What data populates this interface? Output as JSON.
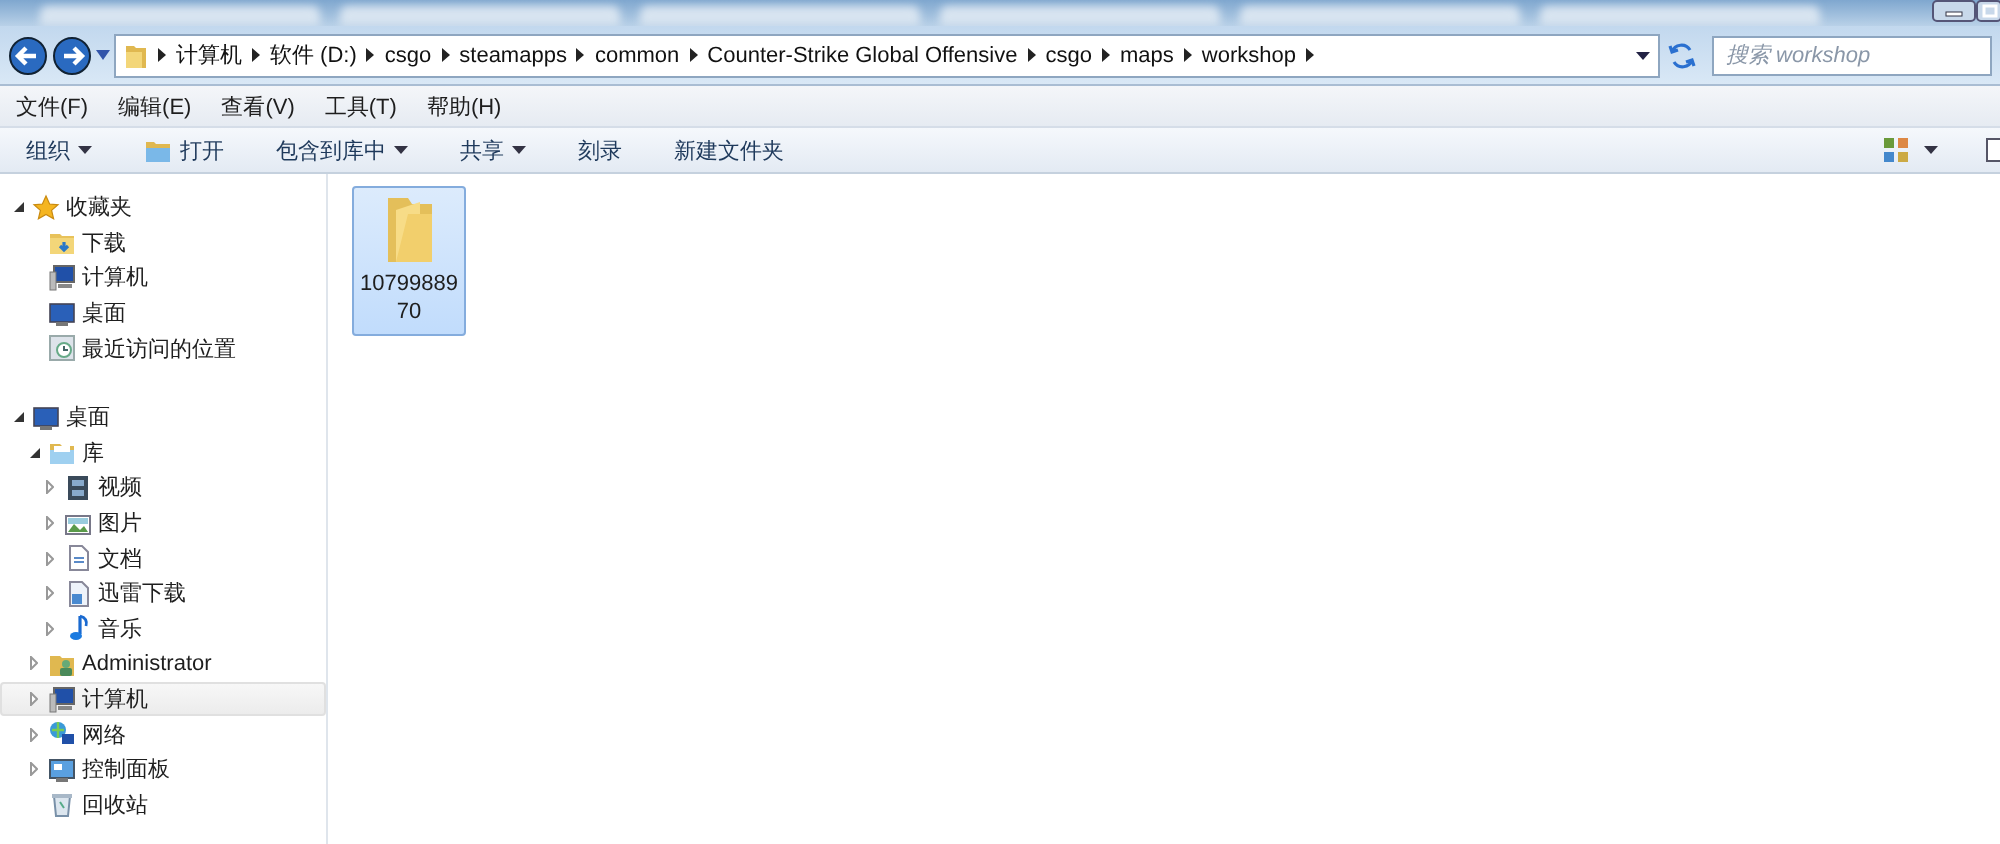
{
  "address_bar": {
    "crumbs": [
      "计算机",
      "软件 (D:)",
      "csgo",
      "steamapps",
      "common",
      "Counter-Strike Global Offensive",
      "csgo",
      "maps",
      "workshop"
    ],
    "search": {
      "placeholder": "搜索 workshop"
    }
  },
  "menu_bar": [
    "文件(F)",
    "编辑(E)",
    "查看(V)",
    "工具(T)",
    "帮助(H)"
  ],
  "toolbar": [
    {
      "label": "组织",
      "kind": "menu"
    },
    {
      "label": "打开",
      "kind": "icon-button"
    },
    {
      "label": "包含到库中",
      "kind": "menu"
    },
    {
      "label": "共享",
      "kind": "menu"
    },
    {
      "label": "刻录",
      "kind": "button"
    },
    {
      "label": "新建文件夹",
      "kind": "button"
    }
  ],
  "navigation_tree": [
    {
      "label": "收藏夹",
      "expanded": true,
      "selected": false,
      "children": [
        {
          "label": "下载",
          "selected": false
        },
        {
          "label": "计算机",
          "selected": false
        },
        {
          "label": "桌面",
          "selected": false
        },
        {
          "label": "最近访问的位置",
          "selected": false
        }
      ]
    },
    {
      "label": "桌面",
      "expanded": true,
      "selected": false,
      "children": [
        {
          "label": "库",
          "expanded": true,
          "selected": false,
          "children": [
            {
              "label": "视频",
              "expanded": false,
              "selected": false
            },
            {
              "label": "图片",
              "expanded": false,
              "selected": false
            },
            {
              "label": "文档",
              "expanded": false,
              "selected": false
            },
            {
              "label": "迅雷下载",
              "expanded": false,
              "selected": false
            },
            {
              "label": "音乐",
              "expanded": false,
              "selected": false
            }
          ]
        },
        {
          "label": "Administrator",
          "expanded": false,
          "selected": false
        },
        {
          "label": "计算机",
          "expanded": false,
          "selected": true
        },
        {
          "label": "网络",
          "expanded": false,
          "selected": false
        },
        {
          "label": "控制面板",
          "expanded": false,
          "selected": false
        },
        {
          "label": "回收站",
          "selected": false
        }
      ]
    }
  ],
  "files": [
    {
      "label": "1079988970",
      "selected": true
    }
  ]
}
